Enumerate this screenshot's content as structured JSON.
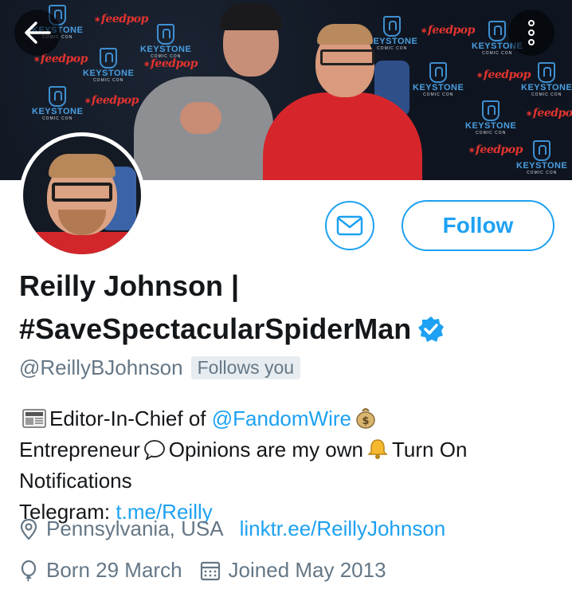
{
  "banner": {
    "backdrop_brand": "KEYSTONE",
    "backdrop_sub": "COMIC CON",
    "backdrop_sponsor": "feedpop"
  },
  "nav": {
    "back_icon": "arrow-left-icon",
    "more_icon": "more-vertical-icon"
  },
  "profile": {
    "name_line1": "Reilly Johnson |",
    "name_line2": "#SaveSpectacularSpiderMan",
    "handle": "@ReillyBJohnson",
    "follows_you": "Follows you",
    "verified": true
  },
  "actions": {
    "message_icon": "envelope-icon",
    "follow_label": "Follow"
  },
  "bio": {
    "p1": "Editor-In-Chief of ",
    "mention": "@FandomWire",
    "p2": "Entrepreneur",
    "p3": "Opinions are my own",
    "p4": "Turn On Notifications",
    "p5": "Telegram: ",
    "telegram_link": "t.me/Reilly"
  },
  "meta": {
    "location": "Pennsylvania, USA",
    "website": "linktr.ee/ReillyJohnson",
    "birthday": "Born 29 March",
    "joined": "Joined May 2013"
  },
  "colors": {
    "accent": "#1da1f2",
    "secondary_text": "#657786",
    "primary_text": "#14171a"
  }
}
